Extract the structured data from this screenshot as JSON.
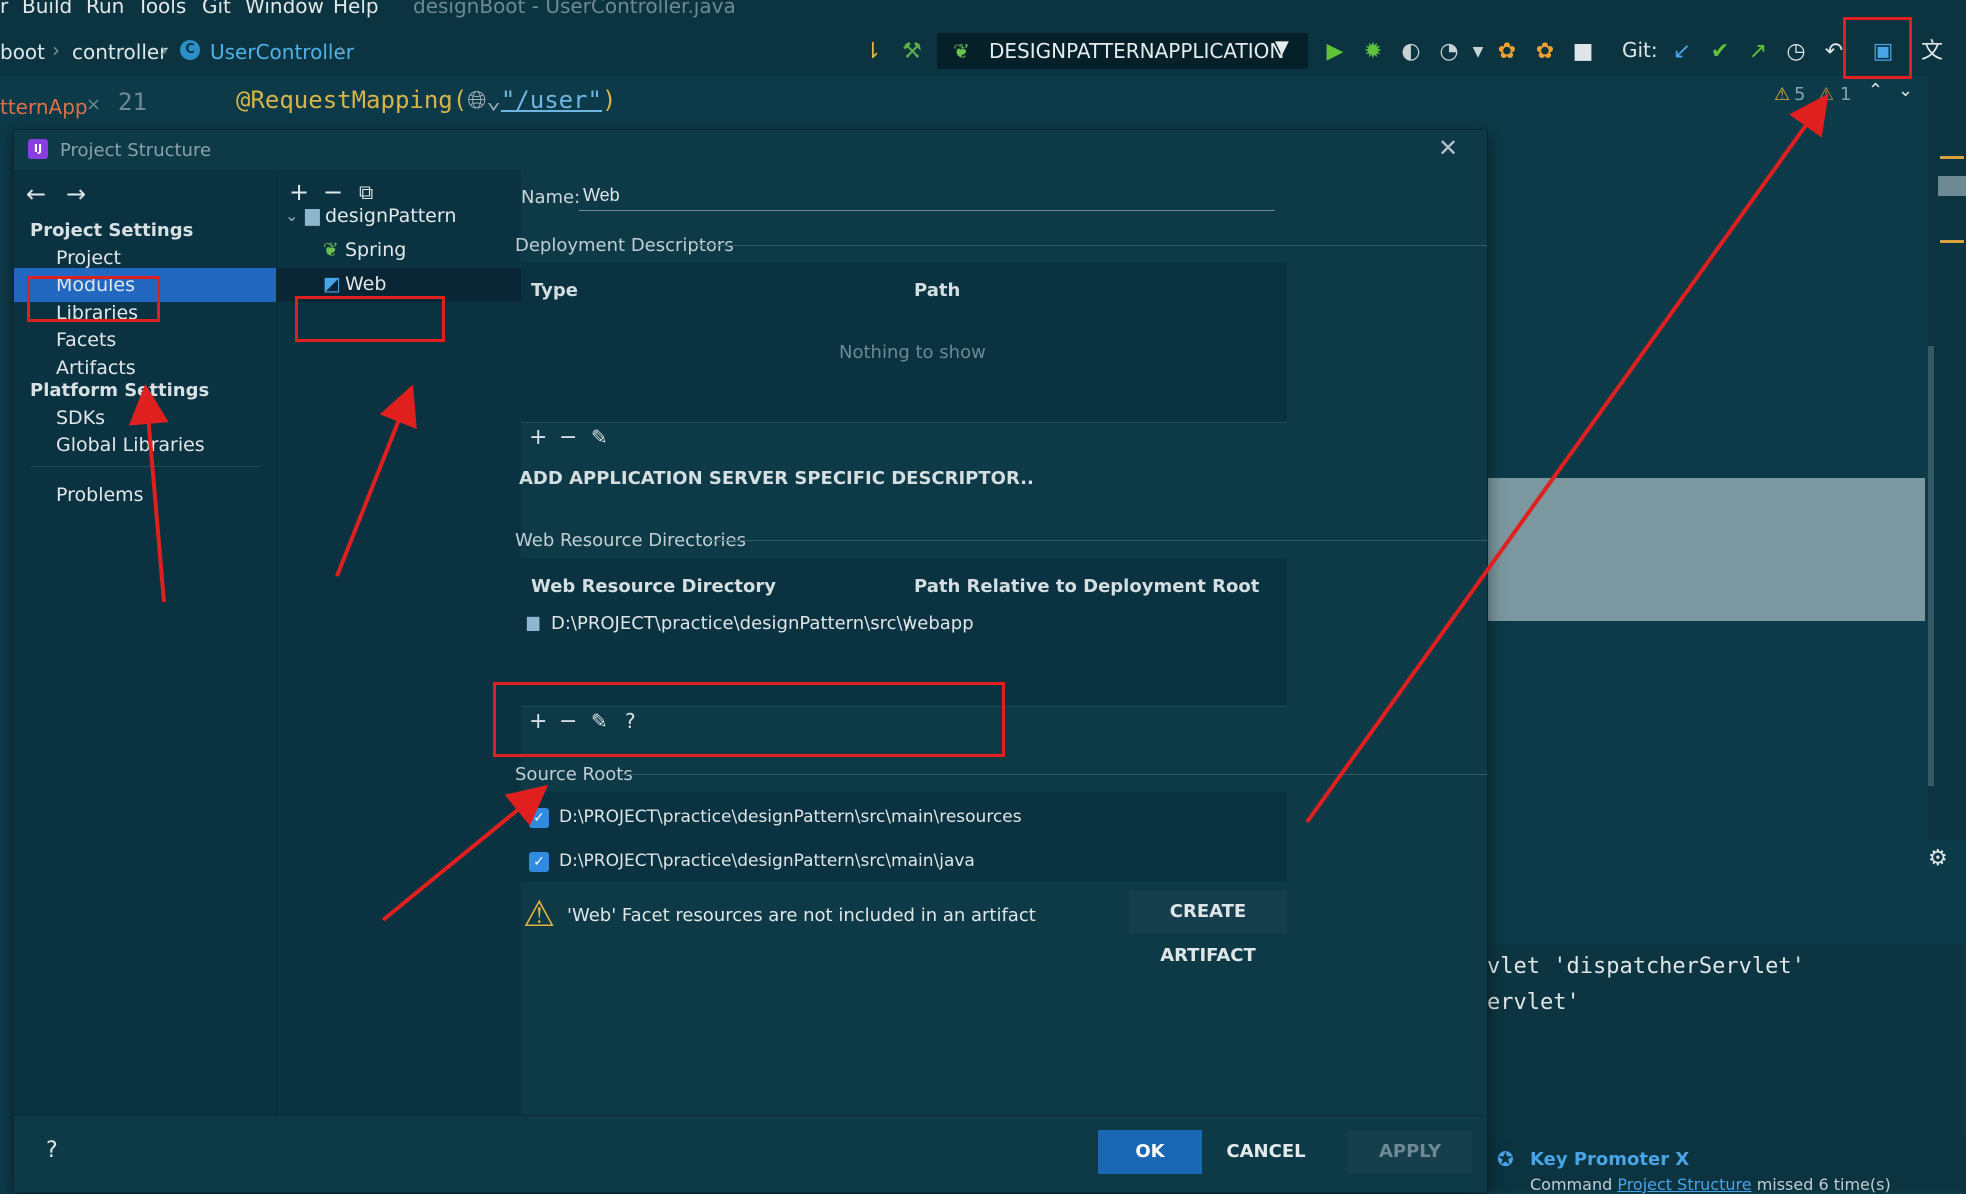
{
  "menu": {
    "items": [
      "r",
      "Build",
      "Run",
      "Tools",
      "Git",
      "Window",
      "Help"
    ],
    "window_title": "designBoot - UserController.java"
  },
  "breadcrumb": {
    "items": [
      "boot",
      "controller",
      "UserController"
    ]
  },
  "toolbar": {
    "run_config": "DESIGNPATTERNAPPLICATION",
    "git_label": "Git:"
  },
  "editor": {
    "tab_label": "tternApp",
    "line_numbers": [
      "21"
    ],
    "code_line": "@RequestMapping(",
    "code_path": "\"/user\"",
    "code_close": ")",
    "warnings": "5",
    "weak_warnings": "1"
  },
  "console": {
    "line1": "vlet 'dispatcherServlet'",
    "line2": "ervlet'"
  },
  "key_promoter": {
    "title": "Key Promoter X",
    "msg_prefix": "Command",
    "msg_link": "Project Structure",
    "msg_suffix": "missed 6 time(s)"
  },
  "dialog": {
    "title": "Project Structure",
    "nav": {
      "project_settings": "Project Settings",
      "project": "Project",
      "modules": "Modules",
      "libraries": "Libraries",
      "facets": "Facets",
      "artifacts": "Artifacts",
      "platform_settings": "Platform Settings",
      "sdks": "SDKs",
      "global_libraries": "Global Libraries",
      "problems": "Problems"
    },
    "tree": {
      "root": "designPattern",
      "spring": "Spring",
      "web": "Web"
    },
    "name_label": "Name:",
    "name_value": "Web",
    "deployment": {
      "section": "Deployment Descriptors",
      "col_type": "Type",
      "col_path": "Path",
      "empty": "Nothing to show",
      "add_server": "ADD APPLICATION SERVER SPECIFIC DESCRIPTOR.."
    },
    "web_resources": {
      "section": "Web Resource Directories",
      "col_dir": "Web Resource Directory",
      "col_rel": "Path Relative to Deployment Root",
      "row_dir": "D:\\PROJECT\\practice\\designPattern\\src\\webapp",
      "row_rel": "/",
      "help": "?"
    },
    "source_roots": {
      "section": "Source Roots",
      "items": [
        "D:\\PROJECT\\practice\\designPattern\\src\\main\\resources",
        "D:\\PROJECT\\practice\\designPattern\\src\\main\\java"
      ]
    },
    "warning": "'Web' Facet resources are not included in an artifact",
    "create_artifact": "CREATE ARTIFACT",
    "footer": {
      "help": "?",
      "ok": "OK",
      "cancel": "CANCEL",
      "apply": "APPLY"
    }
  },
  "colors": {
    "accent": "#2268c1",
    "annotation_red": "#e0201f",
    "ok_button": "#1a67b3"
  }
}
